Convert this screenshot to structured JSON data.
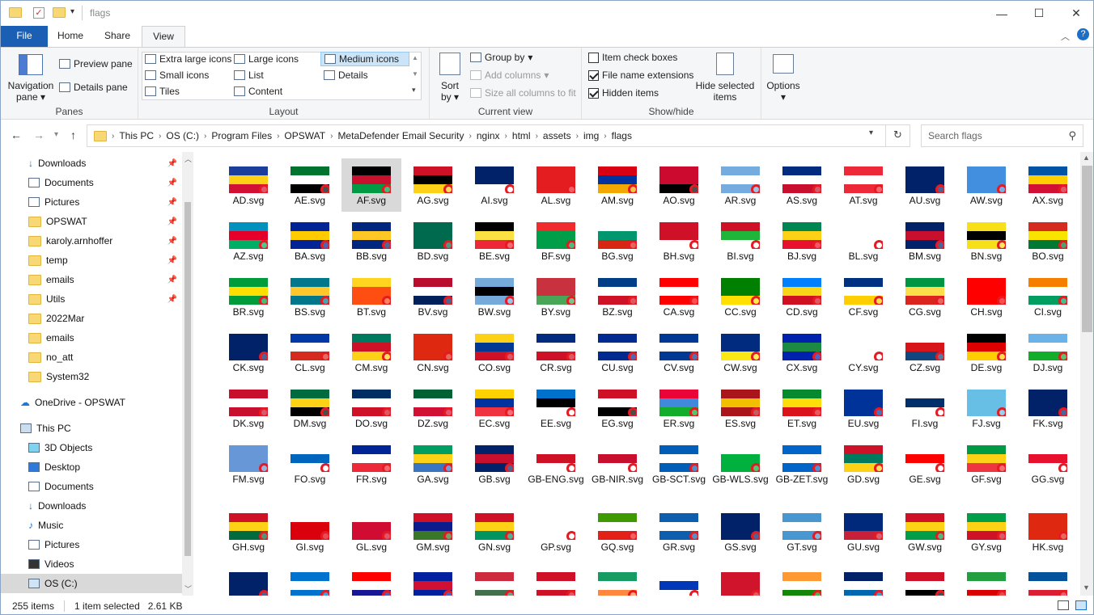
{
  "window": {
    "title": "flags"
  },
  "tabs": {
    "file": "File",
    "home": "Home",
    "share": "Share",
    "view": "View"
  },
  "ribbon": {
    "panes": {
      "navigation": "Navigation",
      "navigation2": "pane",
      "preview": "Preview pane",
      "details": "Details pane",
      "label": "Panes"
    },
    "layout": {
      "xl": "Extra large icons",
      "large": "Large icons",
      "medium": "Medium icons",
      "small": "Small icons",
      "list": "List",
      "details": "Details",
      "tiles": "Tiles",
      "content": "Content",
      "label": "Layout"
    },
    "current": {
      "sort": "Sort",
      "by": "by",
      "group": "Group by",
      "addcol": "Add columns",
      "sizeall": "Size all columns to fit",
      "label": "Current view"
    },
    "showhide": {
      "checkboxes": "Item check boxes",
      "extensions": "File name extensions",
      "hidden": "Hidden items",
      "hidesel": "Hide selected",
      "hidesel2": "items",
      "label": "Show/hide"
    },
    "options": {
      "label": "Options"
    }
  },
  "address": {
    "crumbs": [
      "This PC",
      "OS (C:)",
      "Program Files",
      "OPSWAT",
      "MetaDefender Email Security",
      "nginx",
      "html",
      "assets",
      "img",
      "flags"
    ]
  },
  "search": {
    "placeholder": "Search flags"
  },
  "nav": {
    "items": [
      "Downloads",
      "Documents",
      "Pictures",
      "OPSWAT",
      "karoly.arnhoffer",
      "temp",
      "emails",
      "Utils",
      "2022Mar",
      "emails",
      "no_att",
      "System32",
      "OneDrive - OPSWAT",
      "This PC",
      "3D Objects",
      "Desktop",
      "Documents",
      "Downloads",
      "Music",
      "Pictures",
      "Videos",
      "OS (C:)"
    ]
  },
  "files": [
    "AD.svg",
    "AE.svg",
    "AF.svg",
    "AG.svg",
    "AI.svg",
    "AL.svg",
    "AM.svg",
    "AO.svg",
    "AR.svg",
    "AS.svg",
    "AT.svg",
    "AU.svg",
    "AW.svg",
    "AX.svg",
    "AZ.svg",
    "BA.svg",
    "BB.svg",
    "BD.svg",
    "BE.svg",
    "BF.svg",
    "BG.svg",
    "BH.svg",
    "BI.svg",
    "BJ.svg",
    "BL.svg",
    "BM.svg",
    "BN.svg",
    "BO.svg",
    "BR.svg",
    "BS.svg",
    "BT.svg",
    "BV.svg",
    "BW.svg",
    "BY.svg",
    "BZ.svg",
    "CA.svg",
    "CC.svg",
    "CD.svg",
    "CF.svg",
    "CG.svg",
    "CH.svg",
    "CI.svg",
    "CK.svg",
    "CL.svg",
    "CM.svg",
    "CN.svg",
    "CO.svg",
    "CR.svg",
    "CU.svg",
    "CV.svg",
    "CW.svg",
    "CX.svg",
    "CY.svg",
    "CZ.svg",
    "DE.svg",
    "DJ.svg",
    "DK.svg",
    "DM.svg",
    "DO.svg",
    "DZ.svg",
    "EC.svg",
    "EE.svg",
    "EG.svg",
    "ER.svg",
    "ES.svg",
    "ET.svg",
    "EU.svg",
    "FI.svg",
    "FJ.svg",
    "FK.svg",
    "FM.svg",
    "FO.svg",
    "FR.svg",
    "GA.svg",
    "GB.svg",
    "GB-ENG.svg",
    "GB-NIR.svg",
    "GB-SCT.svg",
    "GB-WLS.svg",
    "GB-ZET.svg",
    "GD.svg",
    "GE.svg",
    "GF.svg",
    "GG.svg",
    "GH.svg",
    "GI.svg",
    "GL.svg",
    "GM.svg",
    "GN.svg",
    "GP.svg",
    "GQ.svg",
    "GR.svg",
    "GS.svg",
    "GT.svg",
    "GU.svg",
    "GW.svg",
    "GY.svg",
    "HK.svg",
    "",
    "",
    "",
    "",
    "",
    "",
    "",
    "",
    "",
    "",
    "",
    "",
    "",
    ""
  ],
  "flagcolors": [
    [
      "#1b3d9b",
      "#fcd116",
      "#d21034"
    ],
    [
      "#00732f",
      "#ffffff",
      "#000000"
    ],
    [
      "#000000",
      "#c8102e",
      "#009a44"
    ],
    [
      "#ce1126",
      "#000000",
      "#fcd116"
    ],
    [
      "#012169",
      "#012169",
      "#ffffff"
    ],
    [
      "#e41e20",
      "#e41e20",
      "#e41e20"
    ],
    [
      "#d90012",
      "#0033a0",
      "#f2a800"
    ],
    [
      "#cc092f",
      "#cc092f",
      "#000000"
    ],
    [
      "#74acdf",
      "#ffffff",
      "#74acdf"
    ],
    [
      "#002b7f",
      "#ffffff",
      "#c8102e"
    ],
    [
      "#ed2939",
      "#ffffff",
      "#ed2939"
    ],
    [
      "#012169",
      "#012169",
      "#012169"
    ],
    [
      "#418fde",
      "#418fde",
      "#418fde"
    ],
    [
      "#0053a5",
      "#ffce00",
      "#d21034"
    ],
    [
      "#0092bc",
      "#e4002b",
      "#00af66"
    ],
    [
      "#002395",
      "#fecb00",
      "#002395"
    ],
    [
      "#00267f",
      "#ffc726",
      "#00267f"
    ],
    [
      "#006a4e",
      "#006a4e",
      "#006a4e"
    ],
    [
      "#000000",
      "#fae042",
      "#ed2939"
    ],
    [
      "#ef2b2d",
      "#009e49",
      "#009e49"
    ],
    [
      "#ffffff",
      "#00966e",
      "#d62612"
    ],
    [
      "#ce1126",
      "#ce1126",
      "#ffffff"
    ],
    [
      "#ce1126",
      "#1eb53a",
      "#ffffff"
    ],
    [
      "#008751",
      "#fcd116",
      "#e8112d"
    ],
    [
      "#ffffff",
      "#ffffff",
      "#ffffff"
    ],
    [
      "#012169",
      "#c8102e",
      "#012169"
    ],
    [
      "#f7e017",
      "#000000",
      "#f7e017"
    ],
    [
      "#d52b1e",
      "#f9e300",
      "#007934"
    ],
    [
      "#009c3b",
      "#ffdf00",
      "#009c3b"
    ],
    [
      "#00778b",
      "#ffc72c",
      "#00778b"
    ],
    [
      "#ffd520",
      "#ff4e12",
      "#ff4e12"
    ],
    [
      "#ba0c2f",
      "#ffffff",
      "#00205b"
    ],
    [
      "#75aadb",
      "#000000",
      "#75aadb"
    ],
    [
      "#c8313e",
      "#c8313e",
      "#4aa657"
    ],
    [
      "#003f87",
      "#ffffff",
      "#ce1126"
    ],
    [
      "#ff0000",
      "#ffffff",
      "#ff0000"
    ],
    [
      "#008000",
      "#008000",
      "#ffe000"
    ],
    [
      "#007fff",
      "#f7d618",
      "#ce1021"
    ],
    [
      "#003082",
      "#ffffff",
      "#ffce00"
    ],
    [
      "#009543",
      "#fbde4a",
      "#dc241f"
    ],
    [
      "#ff0000",
      "#ff0000",
      "#ff0000"
    ],
    [
      "#f77f00",
      "#ffffff",
      "#009e60"
    ],
    [
      "#012169",
      "#012169",
      "#012169"
    ],
    [
      "#0039a6",
      "#ffffff",
      "#d52b1e"
    ],
    [
      "#007a5e",
      "#ce1126",
      "#fcd116"
    ],
    [
      "#de2910",
      "#de2910",
      "#de2910"
    ],
    [
      "#fcd116",
      "#003893",
      "#ce1126"
    ],
    [
      "#002b7f",
      "#ffffff",
      "#ce1126"
    ],
    [
      "#002a8f",
      "#ffffff",
      "#002a8f"
    ],
    [
      "#003893",
      "#ffffff",
      "#003893"
    ],
    [
      "#002b7f",
      "#002b7f",
      "#f9e814"
    ],
    [
      "#0021ad",
      "#1c8a42",
      "#0021ad"
    ],
    [
      "#ffffff",
      "#ffffff",
      "#ffffff"
    ],
    [
      "#ffffff",
      "#d7141a",
      "#11457e"
    ],
    [
      "#000000",
      "#dd0000",
      "#ffce00"
    ],
    [
      "#6ab2e7",
      "#ffffff",
      "#12ad2b"
    ],
    [
      "#c8102e",
      "#ffffff",
      "#c8102e"
    ],
    [
      "#006b3f",
      "#fcd116",
      "#000000"
    ],
    [
      "#002d62",
      "#ffffff",
      "#ce1126"
    ],
    [
      "#006233",
      "#ffffff",
      "#d21034"
    ],
    [
      "#ffd100",
      "#0033a0",
      "#ef3340"
    ],
    [
      "#0072ce",
      "#000000",
      "#ffffff"
    ],
    [
      "#ce1126",
      "#ffffff",
      "#000000"
    ],
    [
      "#ea0437",
      "#4189dd",
      "#12ad2b"
    ],
    [
      "#aa151b",
      "#f1bf00",
      "#aa151b"
    ],
    [
      "#078930",
      "#fcdd09",
      "#da121a"
    ],
    [
      "#003399",
      "#003399",
      "#003399"
    ],
    [
      "#ffffff",
      "#002f6c",
      "#ffffff"
    ],
    [
      "#68bfe5",
      "#68bfe5",
      "#68bfe5"
    ],
    [
      "#012169",
      "#012169",
      "#012169"
    ],
    [
      "#6797d6",
      "#6797d6",
      "#6797d6"
    ],
    [
      "#ffffff",
      "#0065bd",
      "#ffffff"
    ],
    [
      "#002395",
      "#ffffff",
      "#ed2939"
    ],
    [
      "#009e60",
      "#fcd116",
      "#3a75c4"
    ],
    [
      "#012169",
      "#c8102e",
      "#012169"
    ],
    [
      "#ffffff",
      "#ce1124",
      "#ffffff"
    ],
    [
      "#ffffff",
      "#c8102e",
      "#ffffff"
    ],
    [
      "#005eb8",
      "#ffffff",
      "#005eb8"
    ],
    [
      "#ffffff",
      "#00b140",
      "#00b140"
    ],
    [
      "#0064c8",
      "#ffffff",
      "#0064c8"
    ],
    [
      "#ce1126",
      "#007a5e",
      "#fcd116"
    ],
    [
      "#ffffff",
      "#ff0000",
      "#ffffff"
    ],
    [
      "#009a44",
      "#fcd116",
      "#ef3340"
    ],
    [
      "#ffffff",
      "#e8112d",
      "#ffffff"
    ],
    [
      "#ce1126",
      "#fcd116",
      "#006b3f"
    ],
    [
      "#ffffff",
      "#da000c",
      "#da000c"
    ],
    [
      "#ffffff",
      "#d00c33",
      "#d00c33"
    ],
    [
      "#ce1126",
      "#0c1c8c",
      "#3a7728"
    ],
    [
      "#ce1126",
      "#fcd116",
      "#009460"
    ],
    [
      "#ffffff",
      "#ffffff",
      "#ffffff"
    ],
    [
      "#3e9a00",
      "#ffffff",
      "#e32118"
    ],
    [
      "#0d5eaf",
      "#ffffff",
      "#0d5eaf"
    ],
    [
      "#012169",
      "#012169",
      "#012169"
    ],
    [
      "#4997d0",
      "#ffffff",
      "#4997d0"
    ],
    [
      "#00297b",
      "#00297b",
      "#c62139"
    ],
    [
      "#ce1126",
      "#fcd116",
      "#009e49"
    ],
    [
      "#009e49",
      "#fcd116",
      "#ce1126"
    ],
    [
      "#de2910",
      "#de2910",
      "#de2910"
    ],
    [
      "#012169",
      "#012169",
      "#012169"
    ],
    [
      "#0073cf",
      "#ffffff",
      "#0073cf"
    ],
    [
      "#ff0000",
      "#ffffff",
      "#171796"
    ],
    [
      "#00209f",
      "#d21034",
      "#00209f"
    ],
    [
      "#cd2a3e",
      "#ffffff",
      "#436f4d"
    ],
    [
      "#ce1126",
      "#ffffff",
      "#ce1126"
    ],
    [
      "#169b62",
      "#ffffff",
      "#ff883e"
    ],
    [
      "#ffffff",
      "#0038b8",
      "#ffffff"
    ],
    [
      "#cf142b",
      "#cf142b",
      "#cf142b"
    ],
    [
      "#ff9933",
      "#ffffff",
      "#138808"
    ],
    [
      "#012169",
      "#ffffff",
      "#0067b1"
    ],
    [
      "#ce1126",
      "#ffffff",
      "#000000"
    ],
    [
      "#239f40",
      "#ffffff",
      "#da0000"
    ],
    [
      "#02529c",
      "#ffffff",
      "#dc1e35"
    ]
  ],
  "status": {
    "count": "255 items",
    "selected": "1 item selected",
    "size": "2.61 KB"
  }
}
